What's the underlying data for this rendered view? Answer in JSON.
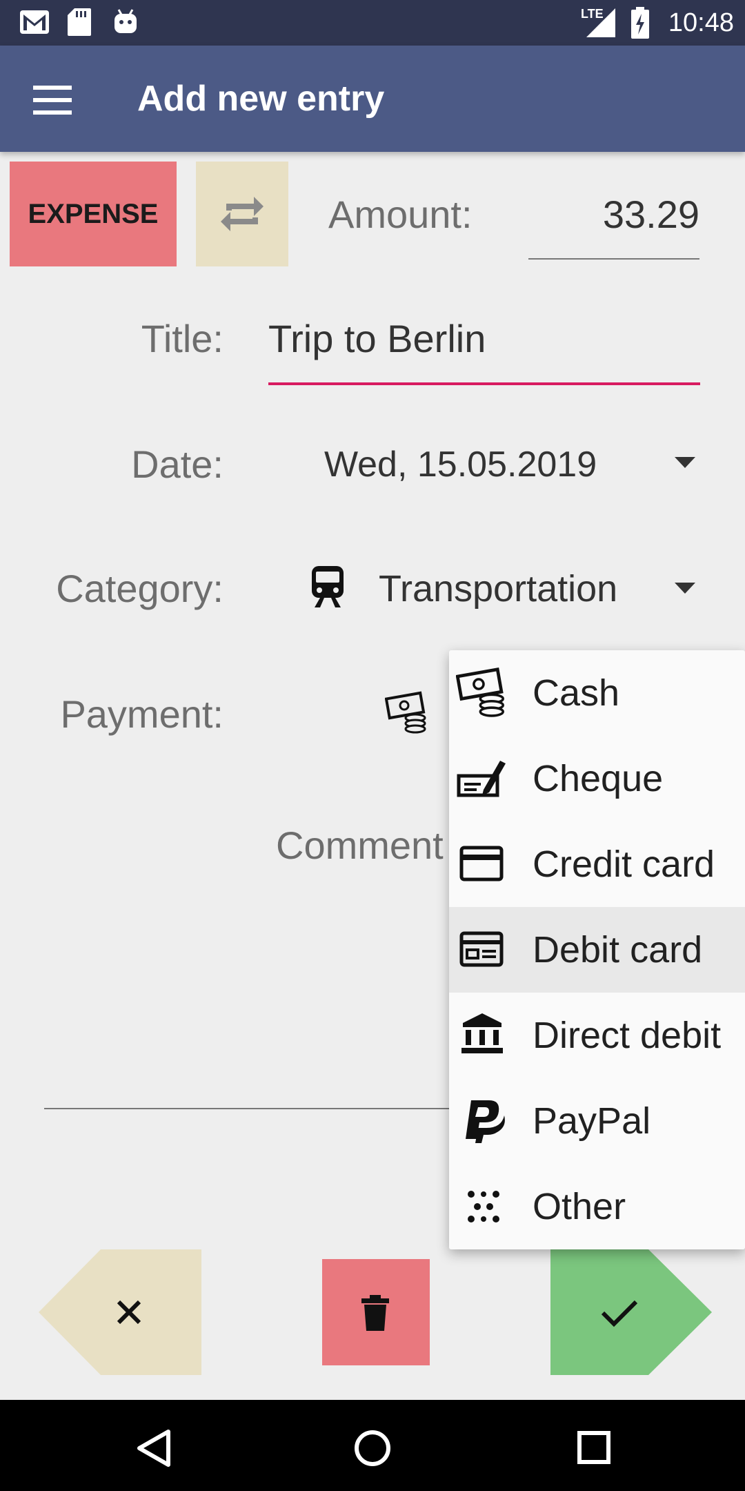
{
  "status_bar": {
    "time": "10:48",
    "network": "LTE",
    "left_icons": [
      "gmail-icon",
      "sd-card-icon",
      "android-icon"
    ],
    "right_icons": [
      "signal-icon",
      "battery-charging-icon"
    ]
  },
  "app_bar": {
    "menu_icon": "hamburger-menu-icon",
    "title": "Add new entry"
  },
  "entry": {
    "type_label": "EXPENSE",
    "swap_icon": "swap-icon",
    "amount_label": "Amount:",
    "amount_value": "33.29",
    "title_label": "Title:",
    "title_value": "Trip to Berlin",
    "date_label": "Date:",
    "date_value": "Wed, 15.05.2019",
    "category_label": "Category:",
    "category_value": "Transportation",
    "category_icon": "train-icon",
    "payment_label": "Payment:",
    "payment_icon": "cash-icon",
    "comment_label": "Comment"
  },
  "payment_menu": {
    "items": [
      {
        "label": "Cash",
        "icon": "cash-icon"
      },
      {
        "label": "Cheque",
        "icon": "cheque-icon"
      },
      {
        "label": "Credit card",
        "icon": "credit-card-icon"
      },
      {
        "label": "Debit card",
        "icon": "debit-card-icon",
        "highlighted": true
      },
      {
        "label": "Direct debit",
        "icon": "bank-icon"
      },
      {
        "label": "PayPal",
        "icon": "paypal-icon"
      },
      {
        "label": "Other",
        "icon": "dots-icon"
      }
    ]
  },
  "actions": {
    "cancel_icon": "close-icon",
    "delete_icon": "delete-icon",
    "confirm_icon": "check-icon"
  },
  "colors": {
    "status_bar": "#2f3550",
    "app_bar": "#4c5a86",
    "expense": "#e9787e",
    "accent_underline": "#d81b60",
    "cancel": "#e8e0c4",
    "confirm": "#7bc67e"
  }
}
